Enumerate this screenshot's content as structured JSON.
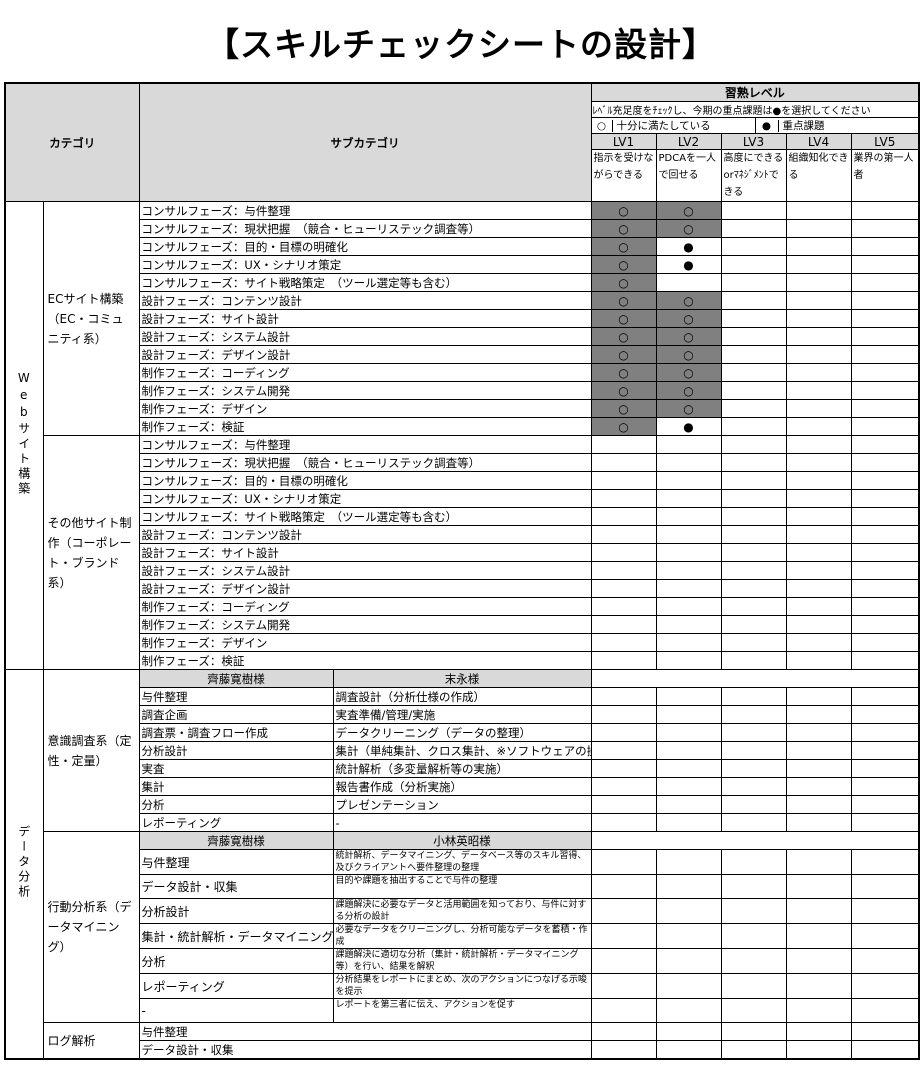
{
  "title": "【スキルチェックシートの設計】",
  "header": {
    "category": "カテゴリ",
    "subcategory": "サブカテゴリ",
    "level_title": "習熟レベル",
    "note": "ﾚﾍﾞﾙ充足度をﾁｪｯｸし、今期の重点課題は●を選択してください",
    "legend_open_symbol": "○",
    "legend_open_text": "十分に満たしている",
    "legend_filled_symbol": "●",
    "legend_filled_text": "重点課題",
    "levels": [
      "LV1",
      "LV2",
      "LV3",
      "LV4",
      "LV5"
    ],
    "level_desc": [
      "指示を受けながらできる",
      "PDCAを一人で回せる",
      "高度にできるorﾏﾈｼﾞﾒﾝﾄできる",
      "組織知化できる",
      "業界の第一人者"
    ]
  },
  "web": {
    "category": "Webサイト構築",
    "ec": {
      "label": "ECサイト構築（EC・コミュニティ系）",
      "rows": [
        {
          "sub": "コンサルフェーズ：与件整理",
          "lv1": "○",
          "lv2": "○"
        },
        {
          "sub": "コンサルフェーズ：現状把握　（競合・ヒューリステック調査等）",
          "lv1": "○",
          "lv2": "○"
        },
        {
          "sub": "コンサルフェーズ：目的・目標の明確化",
          "lv1": "○",
          "lv2": "●"
        },
        {
          "sub": "コンサルフェーズ：UX・シナリオ策定",
          "lv1": "○",
          "lv2": "●"
        },
        {
          "sub": "コンサルフェーズ：サイト戦略策定　（ツール選定等も含む）",
          "lv1": "○",
          "lv2": ""
        },
        {
          "sub": "設計フェーズ：コンテンツ設計",
          "lv1": "○",
          "lv2": "○"
        },
        {
          "sub": "設計フェーズ：サイト設計",
          "lv1": "○",
          "lv2": "○"
        },
        {
          "sub": "設計フェーズ：システム設計",
          "lv1": "○",
          "lv2": "○"
        },
        {
          "sub": "設計フェーズ：デザイン設計",
          "lv1": "○",
          "lv2": "○"
        },
        {
          "sub": "制作フェーズ：コーディング",
          "lv1": "○",
          "lv2": "○"
        },
        {
          "sub": "制作フェーズ：システム開発",
          "lv1": "○",
          "lv2": "○"
        },
        {
          "sub": "制作フェーズ：デザイン",
          "lv1": "○",
          "lv2": "○"
        },
        {
          "sub": "制作フェーズ：検証",
          "lv1": "○",
          "lv2": "●"
        }
      ]
    },
    "other": {
      "label": "その他サイト制作（コーポレート・ブランド系）",
      "rows": [
        "コンサルフェーズ：与件整理",
        "コンサルフェーズ：現状把握　（競合・ヒューリステック調査等）",
        "コンサルフェーズ：目的・目標の明確化",
        "コンサルフェーズ：UX・シナリオ策定",
        "コンサルフェーズ：サイト戦略策定　（ツール選定等も含む）",
        "設計フェーズ：コンテンツ設計",
        "設計フェーズ：サイト設計",
        "設計フェーズ：システム設計",
        "設計フェーズ：デザイン設計",
        "制作フェーズ：コーディング",
        "制作フェーズ：システム開発",
        "制作フェーズ：デザイン",
        "制作フェーズ：検証"
      ]
    }
  },
  "data": {
    "category": "データ分析",
    "survey": {
      "label": "意識調査系（定性・定量）",
      "left_header": "齊藤寛樹様",
      "right_header": "末永様",
      "rows": [
        {
          "left": "与件整理",
          "right": "調査設計（分析仕様の作成）"
        },
        {
          "left": "調査企画",
          "right": "実査準備/管理/実施"
        },
        {
          "left": "調査票・調査フロー作成",
          "right": "データクリーニング（データの整理）"
        },
        {
          "left": "分析設計",
          "right": "集計（単純集計、クロス集計、※ソフトウェアの操作）"
        },
        {
          "left": "実査",
          "right": "統計解析（多変量解析等の実施）"
        },
        {
          "left": "集計",
          "right": "報告書作成（分析実施）"
        },
        {
          "left": "分析",
          "right": "プレゼンテーション"
        },
        {
          "left": "レポーティング",
          "right": "-"
        }
      ]
    },
    "behavior": {
      "label": "行動分析系（データマイニング）",
      "left_header": "齊藤寛樹様",
      "right_header": "小林英昭様",
      "rows": [
        {
          "left": "与件整理",
          "right": "統計解析、データマイニング、データベース等のスキル習得、及びクライアントへ要件整理の整理"
        },
        {
          "left": "データ設計・収集",
          "right": "目的や課題を抽出することで与件の整理"
        },
        {
          "left": "分析設計",
          "right": "課題解決に必要なデータと活用範囲を知っており、与件に対する分析の設計"
        },
        {
          "left": "集計・統計解析・データマイニング",
          "right": "必要なデータをクリーニングし、分析可能なデータを蓄積・作成"
        },
        {
          "left": "分析",
          "right": "課題解決に適切な分析（集計・統計解析・データマイニング等）を行い、結果を解釈"
        },
        {
          "left": "レポーティング",
          "right": "分析結果をレポートにまとめ、次のアクションにつなげる示唆を提示"
        },
        {
          "left": "-",
          "right": "レポートを第三者に伝え、アクションを促す"
        }
      ]
    },
    "log": {
      "label": "ログ解析",
      "rows": [
        "与件整理",
        "データ設計・収集"
      ]
    }
  }
}
